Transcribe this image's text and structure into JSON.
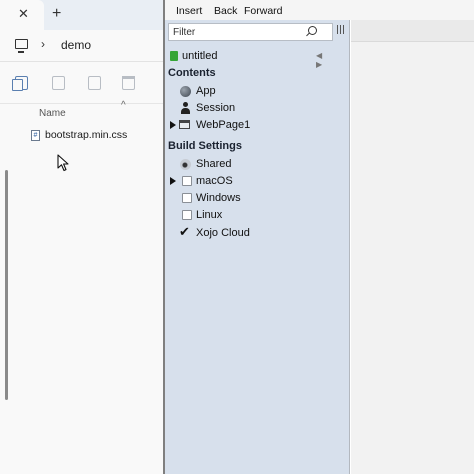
{
  "explorer": {
    "tab_close": "✕",
    "new_tab": "+",
    "address": {
      "chevron": "›",
      "folder": "demo"
    },
    "toolbar_icons": [
      "copy-icon",
      "rename-icon",
      "share-icon",
      "delete-icon"
    ],
    "column_header": "Name",
    "sort_indicator": "^",
    "files": [
      {
        "icon": "#",
        "name": "bootstrap.min.css"
      }
    ]
  },
  "xojo": {
    "toolbar": {
      "insert": "Insert",
      "back": "Back",
      "forward": "Forward"
    },
    "filter": {
      "placeholder": "Filter"
    },
    "project": {
      "name": "untitled",
      "nav_arrows": "◀ ▶"
    },
    "contents": {
      "heading": "Contents",
      "items": [
        {
          "label": "App",
          "icon": "app-icon"
        },
        {
          "label": "Session",
          "icon": "session-icon"
        },
        {
          "label": "WebPage1",
          "icon": "webpage-icon",
          "expandable": true
        }
      ]
    },
    "build_settings": {
      "heading": "Build Settings",
      "items": [
        {
          "label": "Shared",
          "icon": "shared-icon"
        },
        {
          "label": "macOS",
          "checked": false,
          "expandable": true
        },
        {
          "label": "Windows",
          "checked": false
        },
        {
          "label": "Linux",
          "checked": false
        },
        {
          "label": "Xojo Cloud",
          "checked": true
        }
      ]
    },
    "check_mark": "✔"
  },
  "colors": {
    "nav_panel": "#d7e0ec",
    "project_icon": "#36a537",
    "explorer_tabbar": "#e9eef4",
    "divider": "#7f7f7f"
  }
}
